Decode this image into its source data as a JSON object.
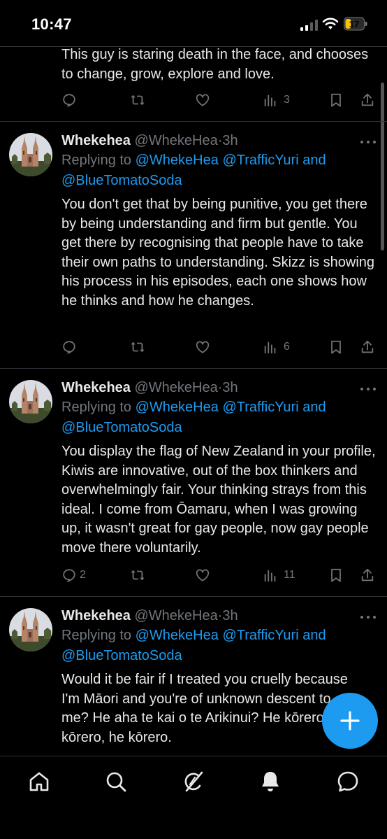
{
  "status_bar": {
    "time": "10:47",
    "battery": "17"
  },
  "tweets": [
    {
      "body": "This guy is staring death in the face, and chooses to change, grow, explore and love.",
      "replies": "",
      "retweets": "",
      "likes": "",
      "views": "3"
    },
    {
      "name": "Whekehea",
      "handle": "@WhekeHea",
      "dot": "·",
      "time": "3h",
      "replying_prefix": "Replying to ",
      "mention_1": "@WhekeHea",
      "mention_2": "@TrafficYuri",
      "mention_joiner": "and",
      "mention_3": "@BlueTomatoSoda",
      "body": "You don't get that by being punitive, you get there by being understanding and firm but gentle. You get there by recognising that people have to take their own paths to understanding. Skizz is showing his process in his episodes, each one shows how he thinks and how he changes.",
      "replies": "",
      "views": "6"
    },
    {
      "name": "Whekehea",
      "handle": "@WhekeHea",
      "dot": "·",
      "time": "3h",
      "replying_prefix": "Replying to ",
      "mention_1": "@WhekeHea",
      "mention_2": "@TrafficYuri",
      "mention_joiner": "and",
      "mention_3": "@BlueTomatoSoda",
      "body": "You display the flag of New Zealand in your profile, Kiwis are innovative, out of the box thinkers and overwhelmingly fair. Your thinking strays from this ideal. I come from Ōamaru, when I was growing up, it wasn't great for gay people, now gay people move there voluntarily.",
      "replies": "2",
      "views": "11"
    },
    {
      "name": "Whekehea",
      "handle": "@WhekeHea",
      "dot": "·",
      "time": "3h",
      "replying_prefix": "Replying to ",
      "mention_1": "@WhekeHea",
      "mention_2": "@TrafficYuri",
      "mention_joiner": "and",
      "mention_3": "@BlueTomatoSoda",
      "body_line_1": "Would it be fair if I treated you cruelly because",
      "body_line_2": "I'm Māori and you're of unknown descent to",
      "body_line_3": "me? He aha te kai o te Arikinui? He kōrero,",
      "body_line_4": "kōrero, he kōrero."
    }
  ],
  "icons": {
    "reply": "reply-icon",
    "retweet": "retweet-icon",
    "like": "heart-icon",
    "views": "views-icon",
    "bookmark": "bookmark-icon",
    "share": "share-icon",
    "compose": "plus-icon",
    "home": "home-icon",
    "search": "search-icon",
    "grok": "grok-icon",
    "notifications": "bell-icon",
    "messages": "message-icon"
  },
  "colors": {
    "accent": "#1d9bf0",
    "muted": "#71767b",
    "text": "#e7e9ea",
    "background": "#000000"
  }
}
